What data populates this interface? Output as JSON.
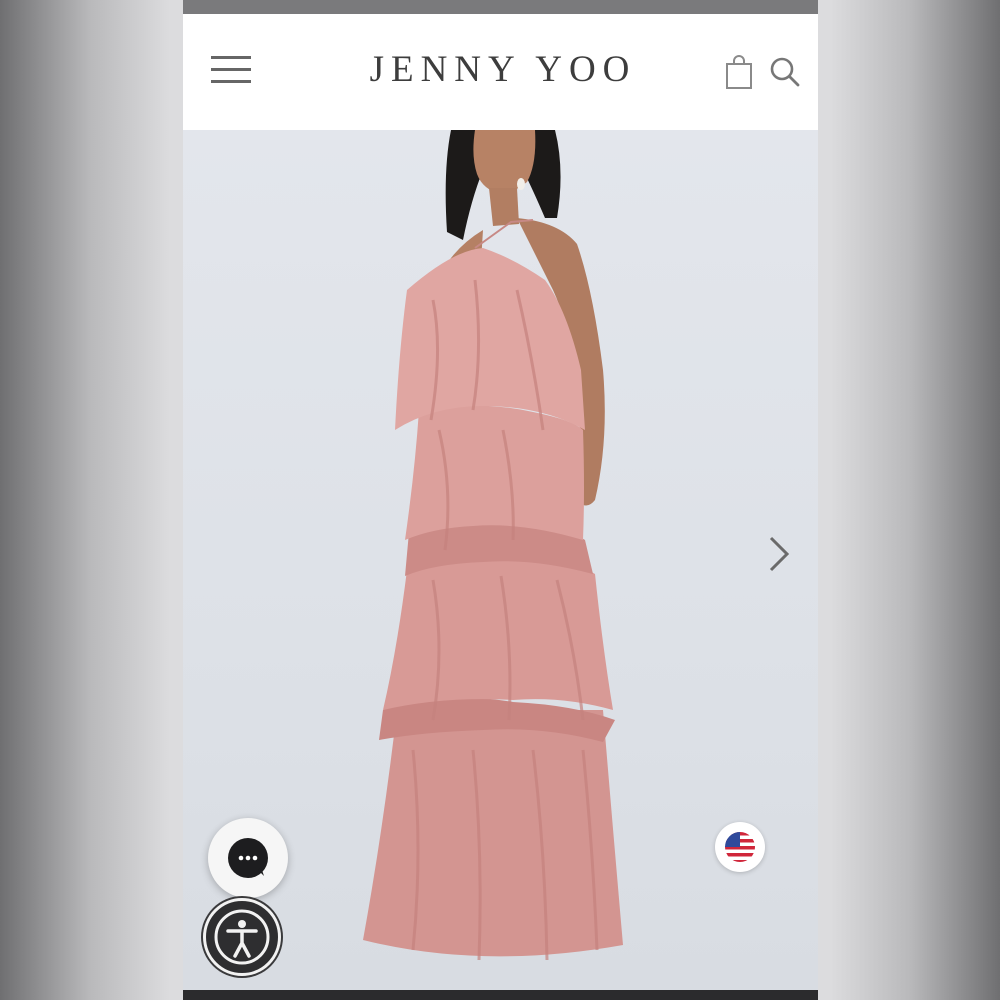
{
  "header": {
    "brand": "JENNY YOO",
    "icons": [
      "menu-icon",
      "shopping-bag-icon",
      "search-icon"
    ]
  },
  "hero": {
    "image_subject": "model-in-blush-tiered-ruffle-halter-gown",
    "next_icon": "chevron-right-icon"
  },
  "widgets": {
    "chat_icon": "chat-bubble-icon",
    "accessibility_icon": "accessibility-icon",
    "country_icon": "us-flag-icon"
  },
  "colors": {
    "dress": "#d89a96",
    "background": "#dfe3e8",
    "header_bg": "#ffffff",
    "brand_text": "#3d3d3d"
  }
}
